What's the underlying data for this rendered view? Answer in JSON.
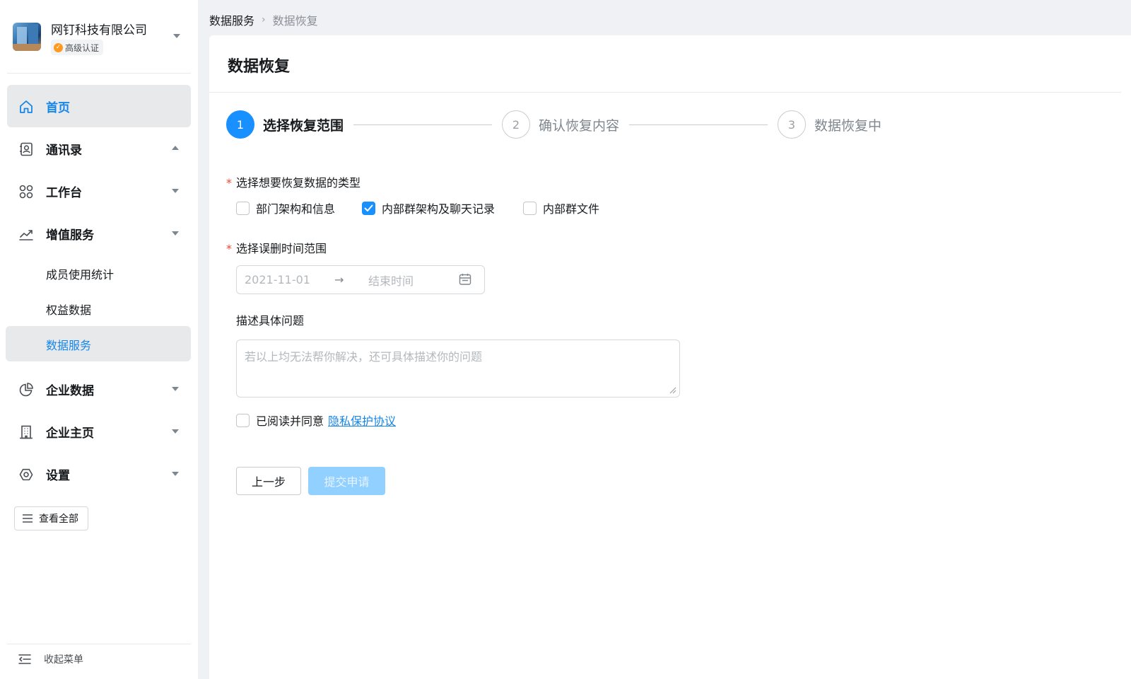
{
  "org": {
    "name": "网钉科技有限公司",
    "badge": "高级认证"
  },
  "nav": {
    "home": "首页",
    "contacts": "通讯录",
    "workbench": "工作台",
    "value_added": "增值服务",
    "sub_member_stats": "成员使用统计",
    "sub_rights_data": "权益数据",
    "sub_data_service": "数据服务",
    "enterprise_data": "企业数据",
    "enterprise_home": "企业主页",
    "settings": "设置",
    "view_all": "查看全部",
    "collapse": "收起菜单"
  },
  "breadcrumb": {
    "parent": "数据服务",
    "current": "数据恢复"
  },
  "page": {
    "title": "数据恢复"
  },
  "steps": [
    {
      "num": "1",
      "label": "选择恢复范围",
      "state": "active"
    },
    {
      "num": "2",
      "label": "确认恢复内容",
      "state": "pending"
    },
    {
      "num": "3",
      "label": "数据恢复中",
      "state": "pending"
    }
  ],
  "form": {
    "type_label": "选择想要恢复数据的类型",
    "required_mark": "*",
    "options": [
      {
        "label": "部门架构和信息",
        "checked": false
      },
      {
        "label": "内部群架构及聊天记录",
        "checked": true
      },
      {
        "label": "内部群文件",
        "checked": false
      }
    ],
    "time_label": "选择误删时间范围",
    "start_date": "2021-11-01",
    "range_arrow": "→",
    "end_placeholder": "结束时间",
    "desc_label": "描述具体问题",
    "desc_placeholder": "若以上均无法帮你解决，还可具体描述你的问题",
    "agree_text": "已阅读并同意",
    "agree_link": "隐私保护协议",
    "agree_checked": false
  },
  "buttons": {
    "prev": "上一步",
    "submit": "提交申请"
  },
  "colors": {
    "accent": "#1890ff",
    "link": "#1586e8",
    "required": "#f5432e",
    "submit_disabled": "#91d0ff"
  }
}
